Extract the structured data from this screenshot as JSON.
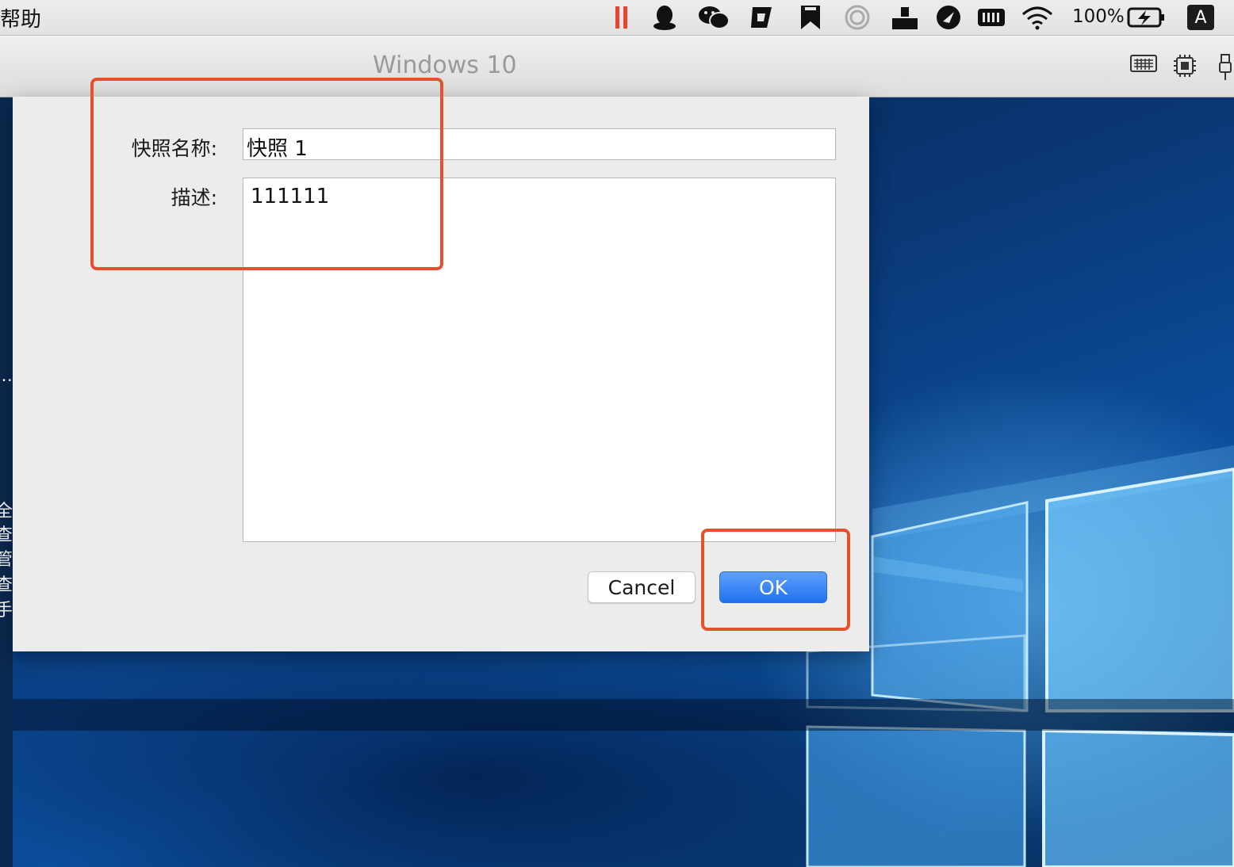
{
  "menubar": {
    "menu_item": "帮助",
    "battery_percent": "100%",
    "input_source": "A",
    "icons": [
      "pause-icon",
      "qq-icon",
      "wechat-icon",
      "g-app-icon",
      "bookmark-app-icon",
      "spiral-app-icon",
      "dropbox-like-icon",
      "feather-icon",
      "memory-icon",
      "wifi-icon",
      "battery-charging-icon"
    ]
  },
  "vm_window": {
    "title": "Windows 10",
    "toolbar_icons": [
      "keyboard-icon",
      "cpu-icon",
      "usb-icon"
    ]
  },
  "desktop_left_strip": [
    "…",
    "全",
    "查",
    "管",
    "查",
    "手"
  ],
  "dialog": {
    "name_label": "快照名称:",
    "name_value": "快照 1",
    "description_label": "描述:",
    "description_value": "111111",
    "cancel_label": "Cancel",
    "ok_label": "OK"
  },
  "colors": {
    "accent_button": "#2171ee",
    "annotation": "#e7502d"
  }
}
